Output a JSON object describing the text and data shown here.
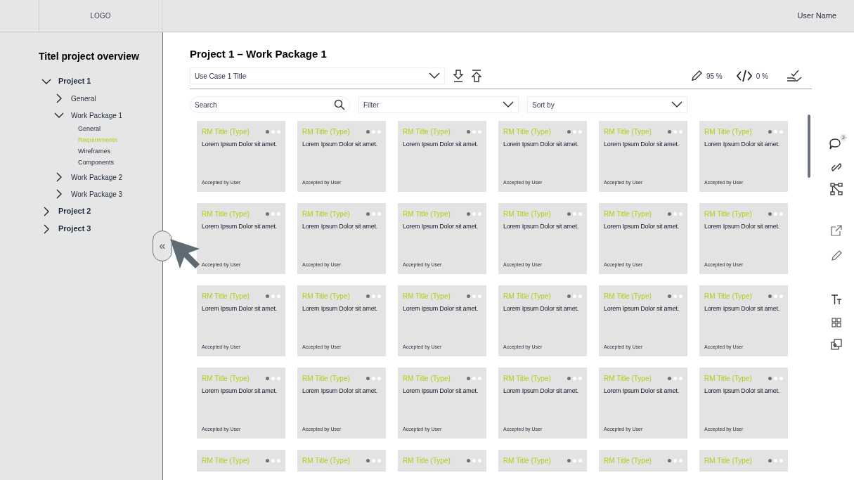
{
  "header": {
    "logo": "LOGO",
    "user_name": "User Name"
  },
  "sidebar": {
    "title": "Titel project overview",
    "collapse_button": "«",
    "tree": [
      {
        "label": "Project 1",
        "expanded": true,
        "selected": false,
        "children": [
          {
            "label": "General",
            "expanded": false,
            "selected": false
          },
          {
            "label": "Work Package 1",
            "expanded": true,
            "selected": false,
            "children": [
              {
                "label": "General",
                "selected": false
              },
              {
                "label": "Requirements",
                "selected": true
              },
              {
                "label": "Wireframes",
                "selected": false
              },
              {
                "label": "Components",
                "selected": false
              }
            ]
          },
          {
            "label": "Work Package 2",
            "expanded": false,
            "selected": false
          },
          {
            "label": "Work Package 3",
            "expanded": false,
            "selected": false
          }
        ]
      },
      {
        "label": "Project 2",
        "expanded": false,
        "selected": false
      },
      {
        "label": "Project 3",
        "expanded": false,
        "selected": false
      }
    ]
  },
  "main": {
    "title": "Project 1 – Work Package 1",
    "use_case_select": "Use Case 1 Title",
    "stats": [
      {
        "kind": "pencil",
        "value": "95 %"
      },
      {
        "kind": "code",
        "value": "0 %"
      }
    ],
    "search": {
      "placeholder": "Search"
    },
    "filter": {
      "placeholder": "Filter"
    },
    "sort": {
      "placeholder": "Sort by"
    },
    "comments_badge": "2",
    "cards": [
      {
        "title": "RM Title (Type)",
        "text": "Lorem Ipsum Dolor sit amet.",
        "footer": "Accepted by User",
        "steps": [
          {
            "done": true
          },
          {
            "done": false
          },
          {
            "done": false
          }
        ]
      },
      {
        "title": "RM Title (Type)",
        "text": "Lorem Ipsum Dolor sit amet.",
        "footer": "Accepted by User",
        "steps": [
          {
            "done": true
          },
          {
            "done": false
          },
          {
            "done": false
          }
        ]
      },
      {
        "title": "RM Title (Type)",
        "text": "Lorem Ipsum Dolor sit amet.",
        "steps": [
          {
            "done": true
          },
          {
            "done": false
          },
          {
            "done": false
          }
        ]
      },
      {
        "title": "RM Title (Type)",
        "text": "Lorem Ipsum Dolor sit amet.",
        "footer": "Accepted by User",
        "steps": [
          {
            "done": true
          },
          {
            "done": false
          },
          {
            "done": false
          }
        ]
      },
      {
        "title": "RM Title (Type)",
        "text": "Lorem Ipsum Dolor sit amet.",
        "footer": "Accepted by User",
        "steps": [
          {
            "done": true
          },
          {
            "done": false
          },
          {
            "done": false
          }
        ]
      },
      {
        "title": "RM Title (Type)",
        "text": "Lorem Ipsum Dolor sit amet.",
        "footer": "Accepted by User",
        "steps": [
          {
            "done": true
          },
          {
            "done": false
          },
          {
            "done": false
          }
        ]
      },
      {
        "title": "RM Title (Type)",
        "text": "Lorem Ipsum Dolor sit amet.",
        "footer": "Accepted by User",
        "steps": [
          {
            "done": true
          },
          {
            "done": false
          },
          {
            "done": false
          }
        ]
      },
      {
        "title": "RM Title (Type)",
        "text": "Lorem Ipsum Dolor sit amet.",
        "footer": "Accepted by User",
        "steps": [
          {
            "done": true
          },
          {
            "done": false
          },
          {
            "done": false
          }
        ]
      },
      {
        "title": "RM Title (Type)",
        "text": "Lorem Ipsum Dolor sit amet.",
        "footer": "Accepted by User",
        "steps": [
          {
            "done": true
          },
          {
            "done": false
          },
          {
            "done": false
          }
        ]
      },
      {
        "title": "RM Title (Type)",
        "text": "Lorem Ipsum Dolor sit amet.",
        "footer": "Accepted by User",
        "steps": [
          {
            "done": true
          },
          {
            "done": false
          },
          {
            "done": false
          }
        ]
      },
      {
        "title": "RM Title (Type)",
        "text": "Lorem Ipsum Dolor sit amet.",
        "footer": "Accepted by User",
        "steps": [
          {
            "done": true
          },
          {
            "done": false
          },
          {
            "done": false
          }
        ]
      },
      {
        "title": "RM Title (Type)",
        "text": "Lorem Ipsum Dolor sit amet.",
        "footer": "Accepted by User",
        "steps": [
          {
            "done": true
          },
          {
            "done": false
          },
          {
            "done": false
          }
        ]
      },
      {
        "title": "RM Title (Type)",
        "text": "Lorem Ipsum Dolor sit amet.",
        "footer": "Accepted by User",
        "steps": [
          {
            "done": true
          },
          {
            "done": false
          },
          {
            "done": false
          }
        ]
      },
      {
        "title": "RM Title (Type)",
        "text": "Lorem Ipsum Dolor sit amet.",
        "footer": "Accepted by User",
        "steps": [
          {
            "done": true
          },
          {
            "done": false
          },
          {
            "done": false
          }
        ]
      },
      {
        "title": "RM Title (Type)",
        "text": "Lorem Ipsum Dolor sit amet.",
        "footer": "Accepted by User",
        "steps": [
          {
            "done": true
          },
          {
            "done": false
          },
          {
            "done": false
          }
        ]
      },
      {
        "title": "RM Title (Type)",
        "text": "Lorem Ipsum Dolor sit amet.",
        "footer": "Accepted by User",
        "steps": [
          {
            "done": true
          },
          {
            "done": false
          },
          {
            "done": false
          }
        ]
      },
      {
        "title": "RM Title (Type)",
        "text": "Lorem Ipsum Dolor sit amet.",
        "footer": "Accepted by User",
        "steps": [
          {
            "done": true
          },
          {
            "done": false
          },
          {
            "done": false
          }
        ]
      },
      {
        "title": "RM Title (Type)",
        "text": "Lorem Ipsum Dolor sit amet.",
        "footer": "Accepted by User",
        "steps": [
          {
            "done": true
          },
          {
            "done": false
          },
          {
            "done": false
          }
        ]
      },
      {
        "title": "RM Title (Type)",
        "text": "Lorem Ipsum Dolor sit amet.",
        "footer": "Accepted by User",
        "steps": [
          {
            "done": true
          },
          {
            "done": false
          },
          {
            "done": false
          }
        ]
      },
      {
        "title": "RM Title (Type)",
        "text": "Lorem Ipsum Dolor sit amet.",
        "footer": "Accepted by User",
        "steps": [
          {
            "done": true
          },
          {
            "done": false
          },
          {
            "done": false
          }
        ]
      },
      {
        "title": "RM Title (Type)",
        "text": "Lorem Ipsum Dolor sit amet.",
        "footer": "Accepted by User",
        "steps": [
          {
            "done": true
          },
          {
            "done": false
          },
          {
            "done": false
          }
        ]
      },
      {
        "title": "RM Title (Type)",
        "text": "Lorem Ipsum Dolor sit amet.",
        "footer": "Accepted by User",
        "steps": [
          {
            "done": true
          },
          {
            "done": false
          },
          {
            "done": false
          }
        ]
      },
      {
        "title": "RM Title (Type)",
        "text": "Lorem Ipsum Dolor sit amet.",
        "footer": "Accepted by User",
        "steps": [
          {
            "done": true
          },
          {
            "done": false
          },
          {
            "done": false
          }
        ]
      },
      {
        "title": "RM Title (Type)",
        "text": "Lorem Ipsum Dolor sit amet.",
        "footer": "Accepted by User",
        "steps": [
          {
            "done": true
          },
          {
            "done": false
          },
          {
            "done": false
          }
        ]
      },
      {
        "title": "RM Title (Type)",
        "steps": [
          {
            "done": true
          },
          {
            "done": false
          },
          {
            "done": false
          }
        ]
      },
      {
        "title": "RM Title (Type)",
        "steps": [
          {
            "done": true
          },
          {
            "done": false
          },
          {
            "done": false
          }
        ]
      },
      {
        "title": "RM Title (Type)",
        "steps": [
          {
            "done": true
          },
          {
            "done": false
          },
          {
            "done": false
          }
        ]
      },
      {
        "title": "RM Title (Type)",
        "steps": [
          {
            "done": true
          },
          {
            "done": false
          },
          {
            "done": false
          }
        ]
      },
      {
        "title": "RM Title (Type)",
        "steps": [
          {
            "done": true
          },
          {
            "done": false
          },
          {
            "done": false
          }
        ]
      },
      {
        "title": "RM Title (Type)",
        "steps": [
          {
            "done": true
          },
          {
            "done": false
          },
          {
            "done": false
          }
        ]
      }
    ]
  }
}
